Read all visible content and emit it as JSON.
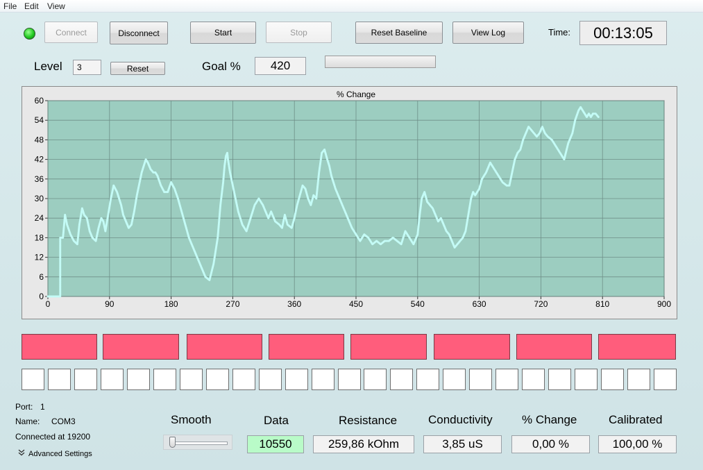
{
  "menu": {
    "file": "File",
    "edit": "Edit",
    "view": "View"
  },
  "toolbar": {
    "connect": "Connect",
    "disconnect": "Disconnect",
    "start": "Start",
    "stop": "Stop",
    "reset_baseline": "Reset Baseline",
    "view_log": "View Log",
    "time_label": "Time:",
    "time_value": "00:13:05",
    "connection_led_color": "#22c922"
  },
  "level": {
    "label": "Level",
    "value": "3",
    "reset": "Reset"
  },
  "goal": {
    "label": "Goal %",
    "value": "420",
    "progress": 0.0
  },
  "chart_data": {
    "type": "scatter",
    "title": "% Change",
    "xlim": [
      0,
      900
    ],
    "ylim": [
      0,
      60
    ],
    "xticks": [
      0,
      90,
      180,
      270,
      360,
      450,
      540,
      630,
      720,
      810,
      900
    ],
    "yticks": [
      0,
      6,
      12,
      18,
      24,
      30,
      36,
      42,
      48,
      54,
      60
    ],
    "grid": true,
    "plot_bg": "#9ccdc0",
    "point_color": "#c4fbf6",
    "series": [
      {
        "values_x": [
          0,
          18,
          18,
          22,
          25,
          28,
          33,
          38,
          43,
          46,
          50,
          53,
          57,
          61,
          65,
          70,
          74,
          78,
          81,
          84,
          88,
          92,
          96,
          101,
          104,
          107,
          110,
          114,
          118,
          122,
          126,
          130,
          134,
          137,
          140,
          143,
          146,
          150,
          154,
          157,
          160,
          165,
          170,
          175,
          180,
          185,
          190,
          194,
          198,
          202,
          206,
          212,
          218,
          224,
          230,
          236,
          242,
          248,
          252,
          256,
          258,
          260,
          262,
          263,
          266,
          270,
          274,
          278,
          284,
          290,
          296,
          302,
          308,
          314,
          318,
          322,
          326,
          332,
          338,
          342,
          346,
          350,
          356,
          360,
          364,
          368,
          372,
          376,
          380,
          384,
          388,
          392,
          396,
          400,
          404,
          408,
          411,
          414,
          420,
          426,
          432,
          438,
          444,
          450,
          456,
          462,
          468,
          474,
          480,
          486,
          492,
          498,
          504,
          510,
          516,
          522,
          528,
          534,
          540,
          543,
          546,
          550,
          554,
          558,
          562,
          566,
          570,
          574,
          578,
          582,
          586,
          590,
          594,
          598,
          602,
          606,
          610,
          614,
          618,
          621,
          624,
          630,
          634,
          640,
          646,
          652,
          658,
          664,
          670,
          674,
          678,
          682,
          686,
          690,
          694,
          698,
          702,
          706,
          710,
          714,
          718,
          722,
          726,
          730,
          736,
          742,
          748,
          754,
          760,
          766,
          770,
          775,
          778,
          781,
          784,
          787,
          790,
          793,
          796,
          800,
          804
        ],
        "values_y": [
          0,
          0,
          18,
          18,
          25,
          22,
          19,
          17,
          16,
          22,
          27,
          25,
          24,
          20,
          18,
          17,
          21,
          24,
          23,
          20,
          25,
          30,
          34,
          32,
          30,
          28,
          25,
          23,
          21,
          22,
          26,
          31,
          35,
          38,
          40,
          42,
          41,
          39,
          38,
          38,
          37,
          34,
          32,
          32,
          35,
          33,
          30,
          27,
          24,
          21,
          18,
          15,
          12,
          9,
          6,
          5,
          10,
          18,
          28,
          35,
          40,
          43,
          44,
          42,
          38,
          34,
          30,
          26,
          22,
          20,
          24,
          28,
          30,
          28,
          26,
          24,
          26,
          23,
          22,
          21,
          25,
          22,
          21,
          24,
          28,
          31,
          34,
          33,
          30,
          28,
          31,
          30,
          38,
          44,
          45,
          42,
          40,
          37,
          33,
          30,
          27,
          24,
          21,
          19,
          17,
          19,
          18,
          16,
          17,
          16,
          17,
          17,
          18,
          17,
          16,
          20,
          18,
          16,
          19,
          25,
          30,
          32,
          29,
          28,
          27,
          25,
          23,
          24,
          22,
          20,
          19,
          17,
          15,
          16,
          17,
          18,
          20,
          25,
          30,
          32,
          31,
          33,
          36,
          38,
          41,
          39,
          37,
          35,
          34,
          34,
          38,
          42,
          44,
          45,
          48,
          50,
          52,
          51,
          50,
          49,
          50,
          52,
          50,
          49,
          48,
          46,
          44,
          42,
          47,
          50,
          54,
          57,
          58,
          57,
          56,
          55,
          56,
          55,
          56,
          56,
          55
        ]
      }
    ]
  },
  "indicators": {
    "red_count": 8,
    "white_count": 25,
    "red_color": "#ff5d7c"
  },
  "info": {
    "port_label": "Port:",
    "port_value": "1",
    "name_label": "Name:",
    "name_value": "COM3",
    "status": "Connected at 19200",
    "advanced": "Advanced Settings"
  },
  "readouts": {
    "smooth_label": "Smooth",
    "data_label": "Data",
    "data_value": "10550",
    "resistance_label": "Resistance",
    "resistance_value": "259,86 kOhm",
    "conductivity_label": "Conductivity",
    "conductivity_value": "3,85 uS",
    "pct_change_label": "% Change",
    "pct_change_value": "0,00 %",
    "calibrated_label": "Calibrated",
    "calibrated_value": "100,00 %"
  }
}
